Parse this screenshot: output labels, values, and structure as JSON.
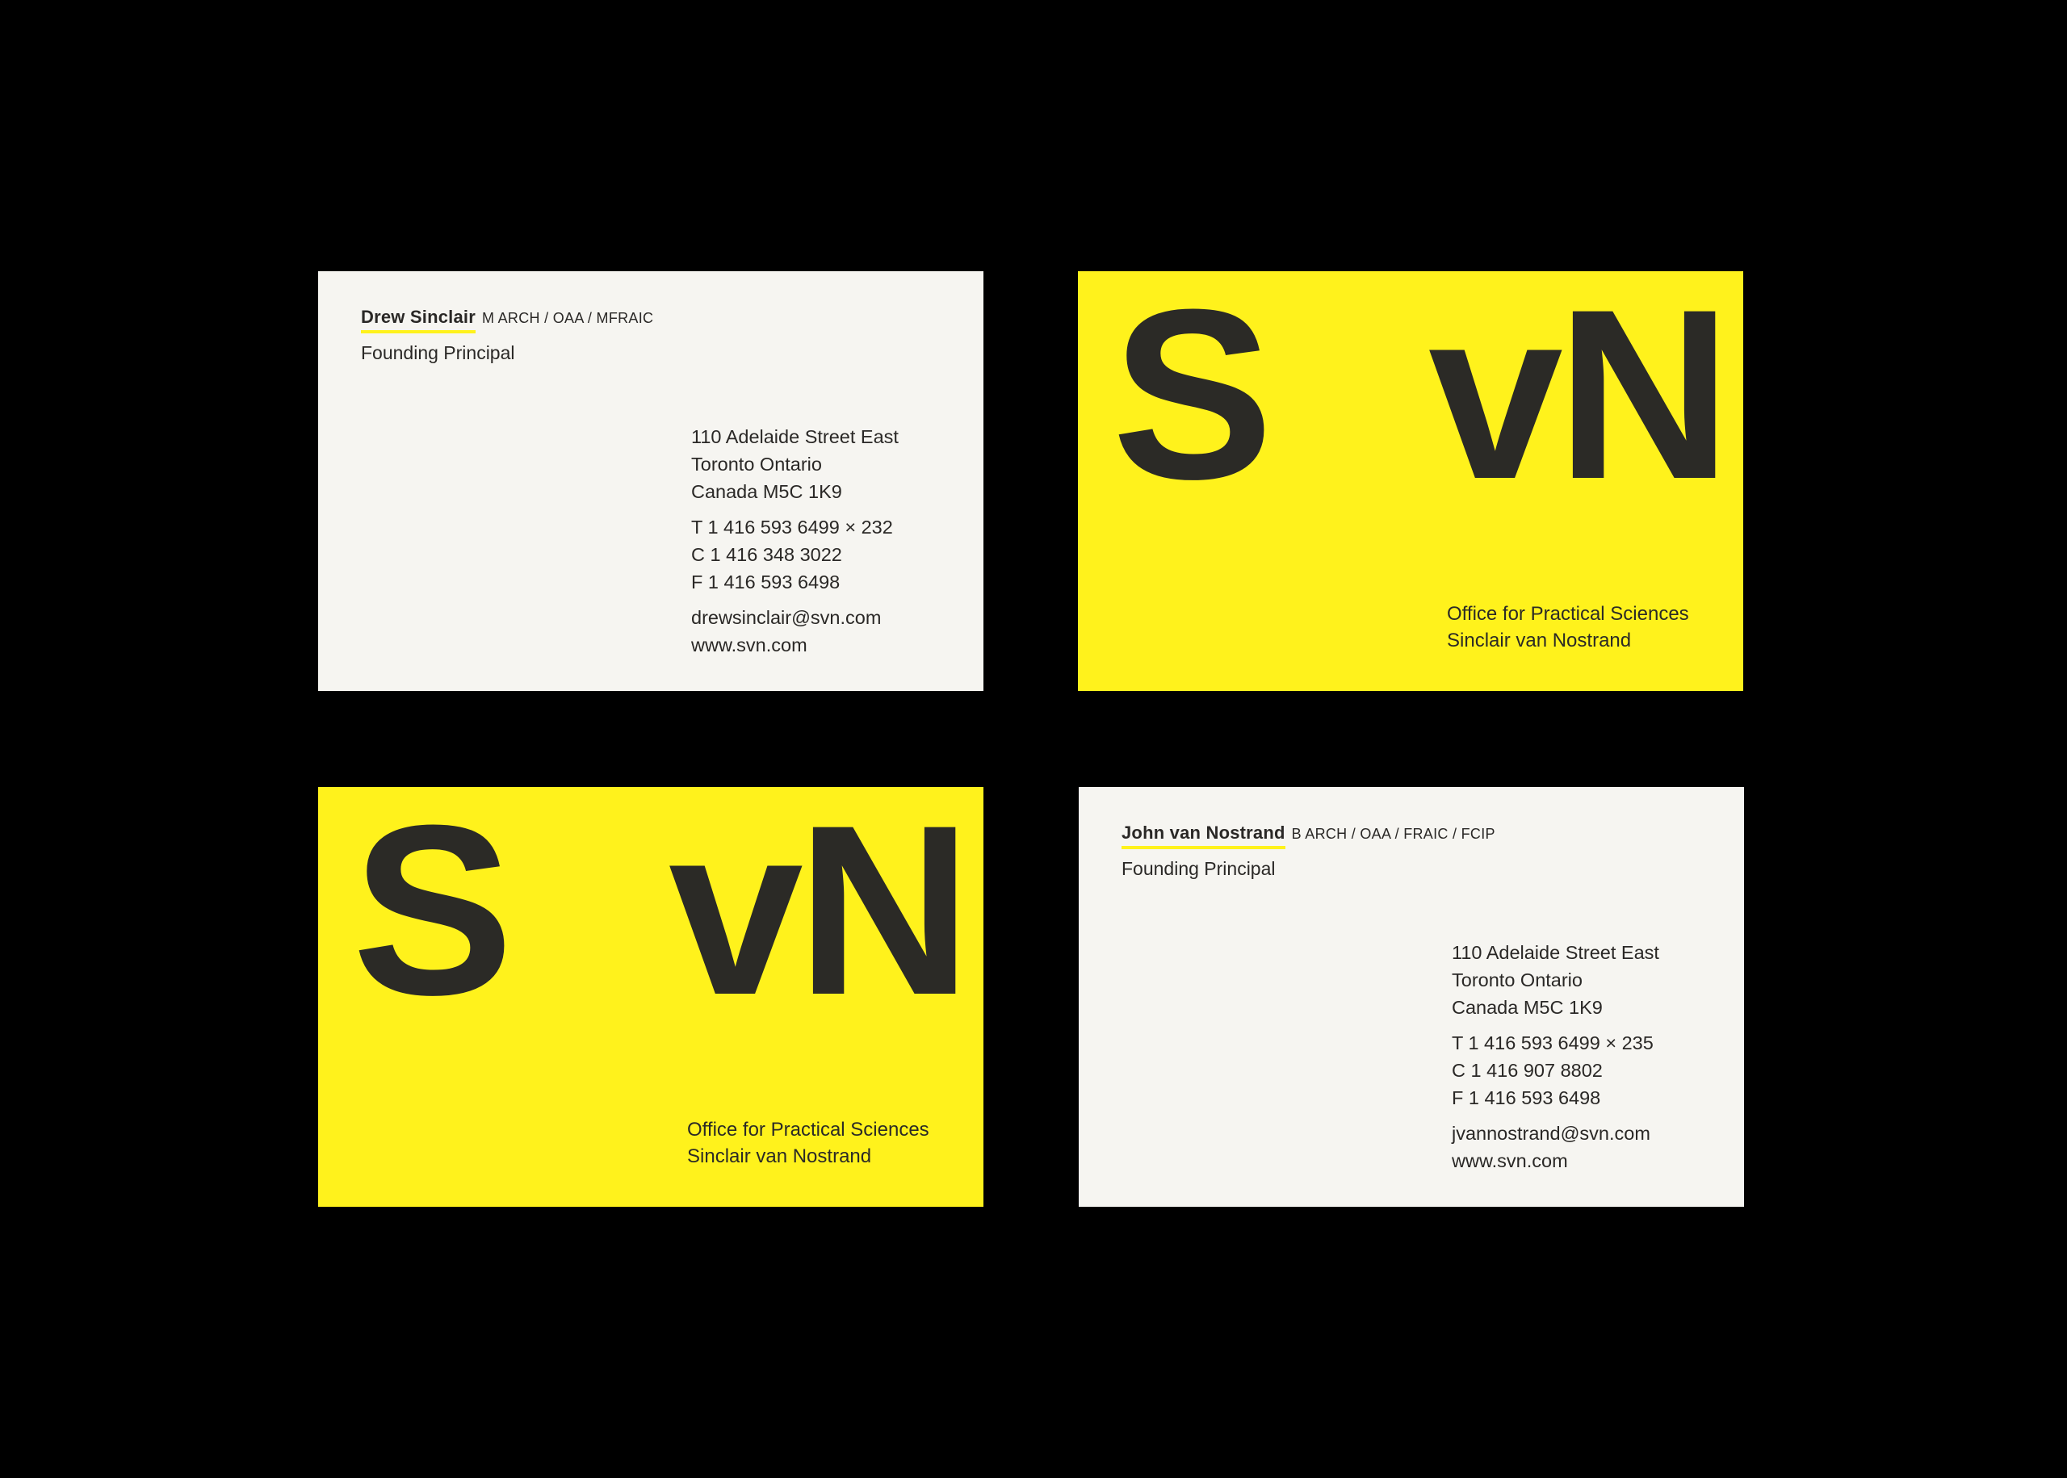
{
  "colors": {
    "background": "#000000",
    "card_white": "#f6f5f1",
    "card_yellow": "#fff21c",
    "ink": "#2a2826"
  },
  "drew_card": {
    "name": "Drew Sinclair",
    "credentials": "M ARCH / OAA / MFRAIC",
    "role": "Founding Principal",
    "address": [
      "110 Adelaide Street East",
      "Toronto Ontario",
      "Canada  M5C 1K9"
    ],
    "phones": [
      "T  1 416 593 6499 × 232",
      "C  1 416 348 3022",
      "F  1 416 593 6498"
    ],
    "email": "drewsinclair@svn.com",
    "website": "www.svn.com"
  },
  "logo_card": {
    "letter_s": "S",
    "letters_vn": "vN",
    "firm_line_1": "Office for Practical Sciences",
    "firm_line_2": "Sinclair van Nostrand"
  },
  "john_card": {
    "name": "John van Nostrand",
    "credentials": "B ARCH / OAA / FRAIC / FCIP",
    "role": "Founding Principal",
    "address": [
      "110 Adelaide Street East",
      "Toronto Ontario",
      "Canada  M5C 1K9"
    ],
    "phones": [
      "T  1 416 593 6499 × 235",
      "C  1 416 907 8802",
      "F  1 416 593 6498"
    ],
    "email": "jvannostrand@svn.com",
    "website": "www.svn.com"
  }
}
